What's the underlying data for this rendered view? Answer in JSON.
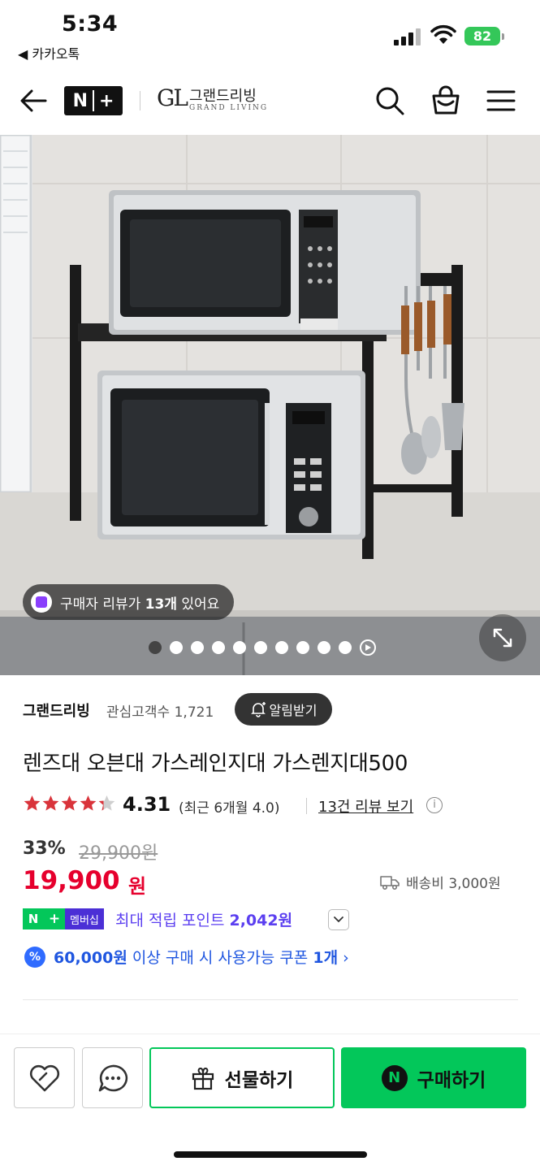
{
  "status_bar": {
    "time": "5:34",
    "back_app": "◀ 카카오톡",
    "battery": "82"
  },
  "header": {
    "badge_n": "N",
    "badge_plus": "+",
    "brand_logo": "GL",
    "brand_ko": "그랜드리빙",
    "brand_en": "GRAND LIVING",
    "icons": [
      "back-arrow-icon",
      "search-icon",
      "shopping-bag-icon",
      "menu-icon"
    ]
  },
  "gallery": {
    "review_pill_prefix": "구매자 리뷰가 ",
    "review_pill_count": "13개",
    "review_pill_suffix": " 있어요",
    "image_count": 10,
    "active_index": 0
  },
  "store": {
    "name": "그랜드리빙",
    "followers_label": "관심고객수 1,721",
    "alarm_button": "알림받기"
  },
  "product": {
    "title": "렌즈대 오븐대 가스레인지대 가스렌지대500",
    "rating_stars": 4.31,
    "rating": "4.31",
    "rating_recent": "(최근 6개월 4.0)",
    "review_link": "13건 리뷰 보기",
    "discount": "33%",
    "original_price": "29,900원",
    "price": "19,900",
    "price_unit": "원",
    "shipping": "배송비 3,000원"
  },
  "membership": {
    "badge_n": "N",
    "badge_plus": "+",
    "badge_label": "멤버십",
    "point_prefix": "최대 적립 포인트 ",
    "point_value": "2,042원"
  },
  "coupon": {
    "icon_text": "%",
    "amount": "60,000원",
    "text": " 이상 구매 시 사용가능 쿠폰 ",
    "count": "1개",
    "chevron": "›"
  },
  "bottom_bar": {
    "gift_label": "선물하기",
    "buy_label": "구매하기",
    "buy_logo": "N"
  },
  "colors": {
    "naver_green": "#03c75a",
    "price_red": "#e6002d",
    "membership_purple": "#5b3ff0",
    "coupon_blue": "#1f56e0"
  }
}
